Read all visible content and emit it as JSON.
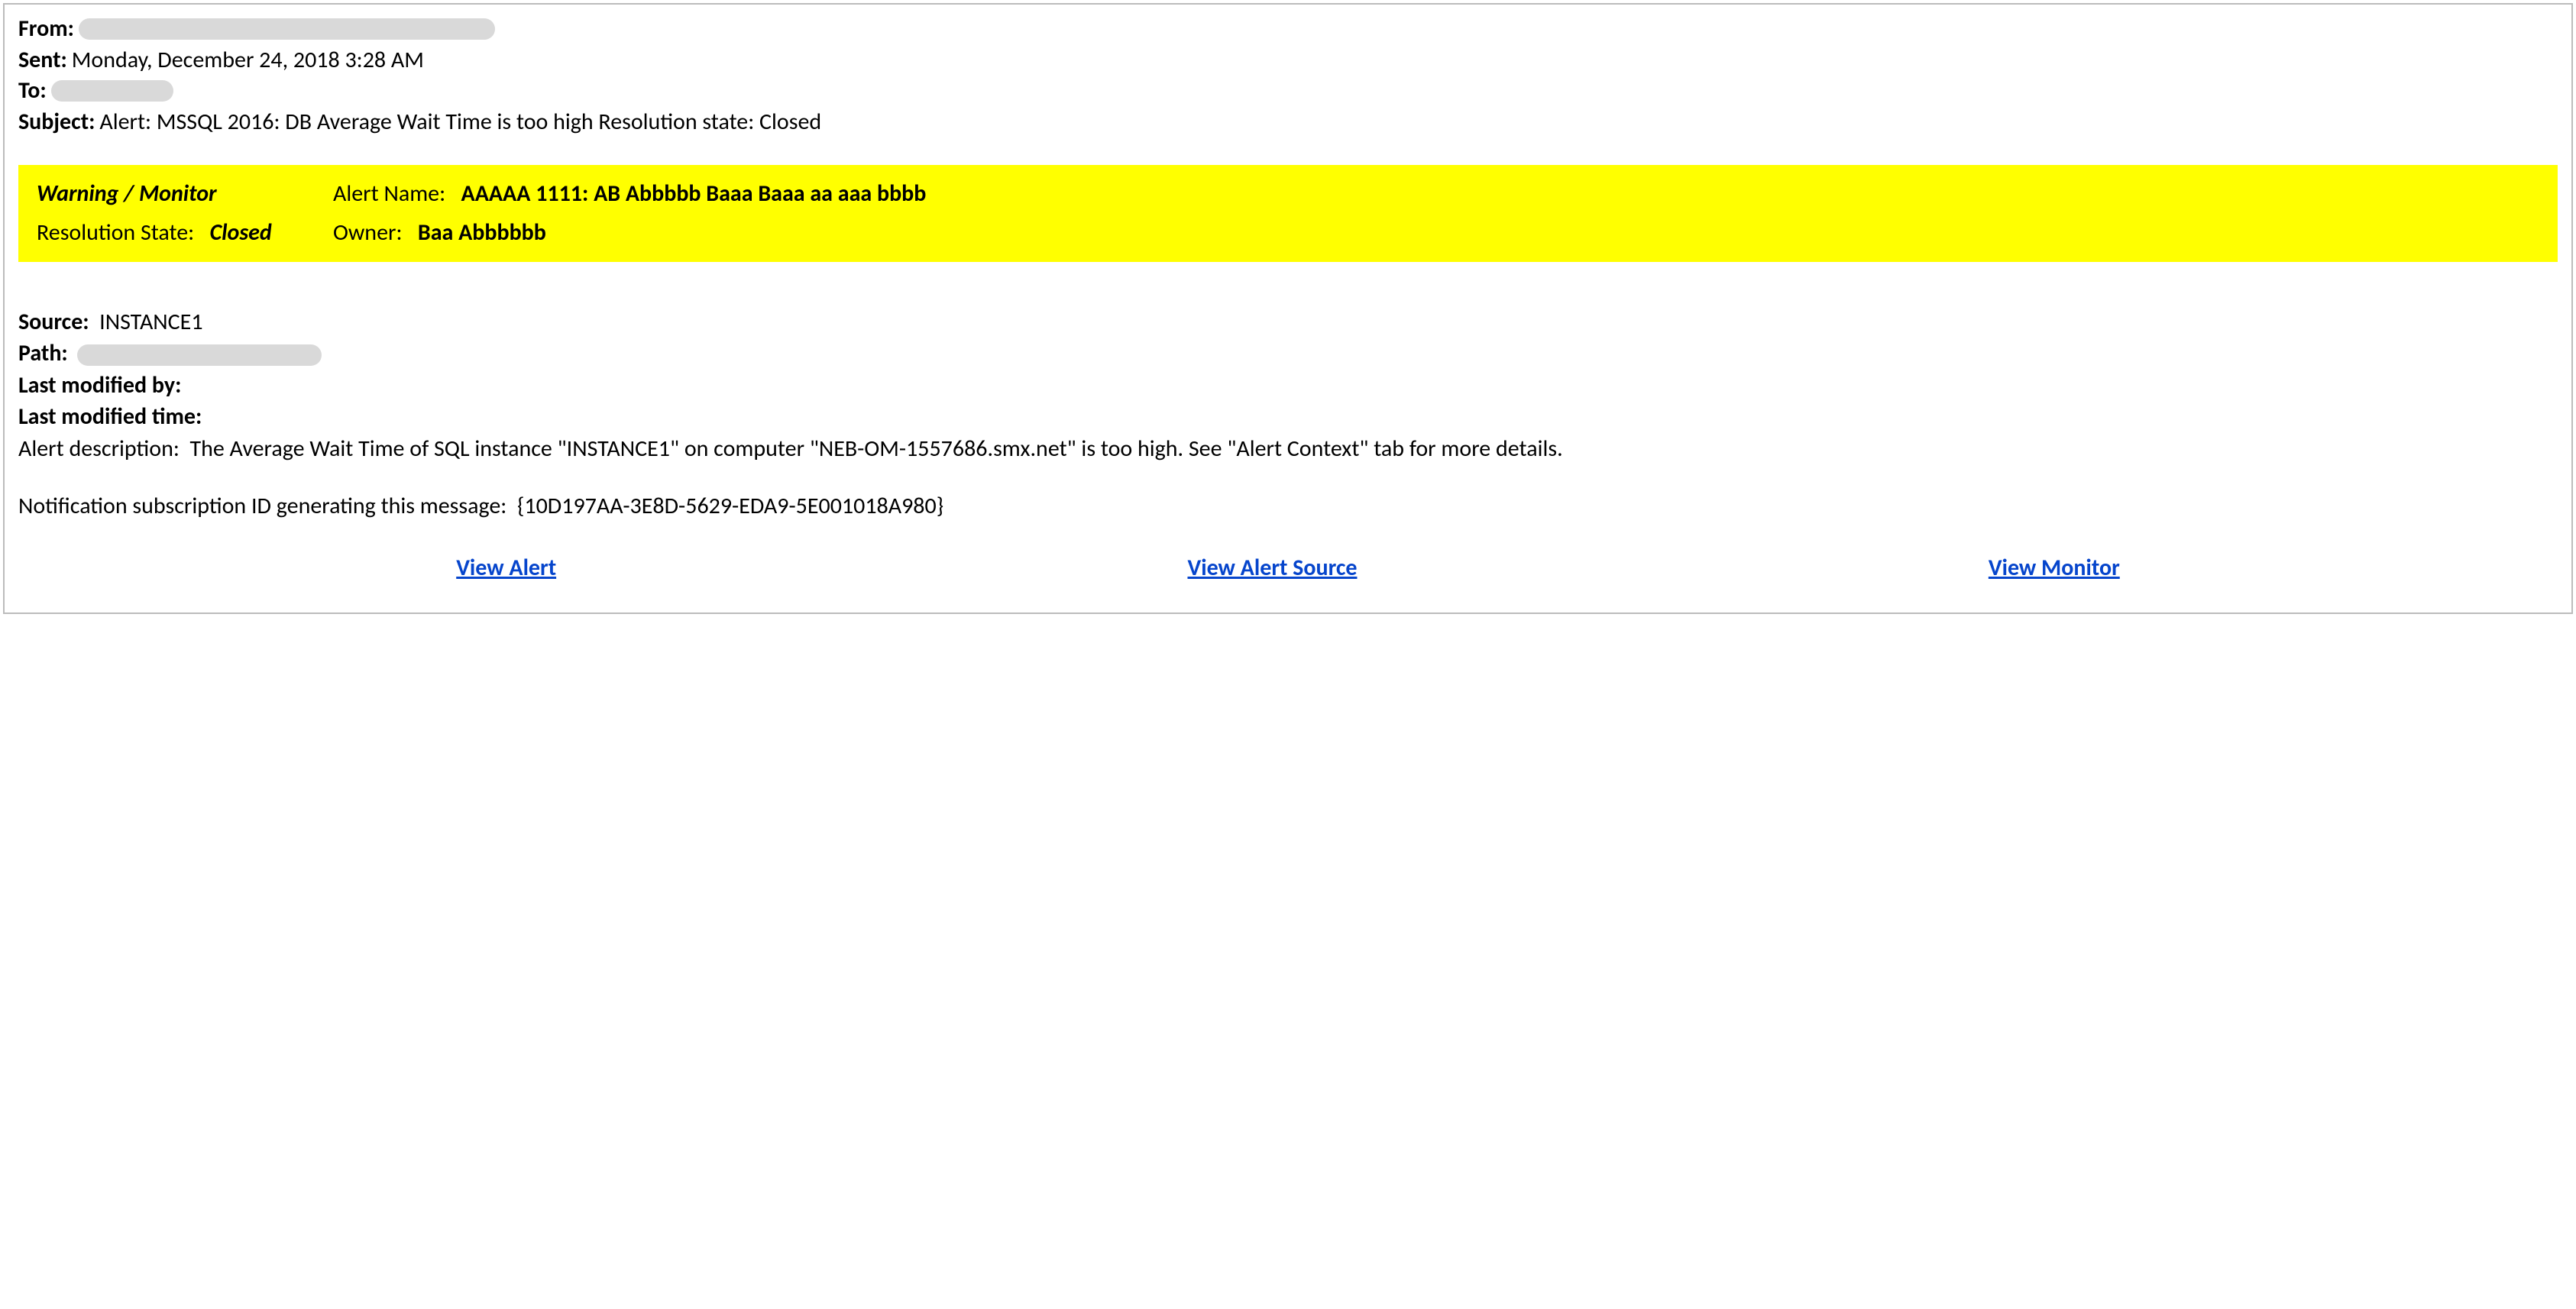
{
  "header": {
    "from_label": "From:",
    "from_value": "",
    "sent_label": "Sent:",
    "sent_value": "Monday, December 24, 2018 3:28 AM",
    "to_label": "To:",
    "to_value": "",
    "subject_label": "Subject:",
    "subject_value": "Alert: MSSQL 2016: DB Average Wait Time is too high Resolution state: Closed"
  },
  "banner": {
    "warning_monitor": "Warning / Monitor",
    "alert_name_label": "Alert Name:",
    "alert_name_value": "AAAAA 1111: AB Abbbbb Baaa Baaa aa aaa bbbb",
    "resolution_state_label": "Resolution State:",
    "resolution_state_value": "Closed",
    "owner_label": "Owner:",
    "owner_value": "Baa Abbbbbb"
  },
  "details": {
    "source_label": "Source:",
    "source_value": "INSTANCE1",
    "path_label": "Path:",
    "path_value": "",
    "last_modified_by_label": "Last modified by:",
    "last_modified_by_value": "",
    "last_modified_time_label": "Last modified time:",
    "last_modified_time_value": "",
    "alert_description_label": "Alert description:",
    "alert_description_value": "The Average Wait Time of SQL instance \"INSTANCE1\" on computer \"NEB-OM-1557686.smx.net\" is too high. See \"Alert Context\" tab for more details.",
    "subscription_id_label": "Notification subscription ID generating this message:",
    "subscription_id_value": "{10D197AA-3E8D-5629-EDA9-5E001018A980}"
  },
  "links": {
    "view_alert": "View Alert",
    "view_alert_source": "View Alert Source",
    "view_monitor": "View Monitor"
  }
}
